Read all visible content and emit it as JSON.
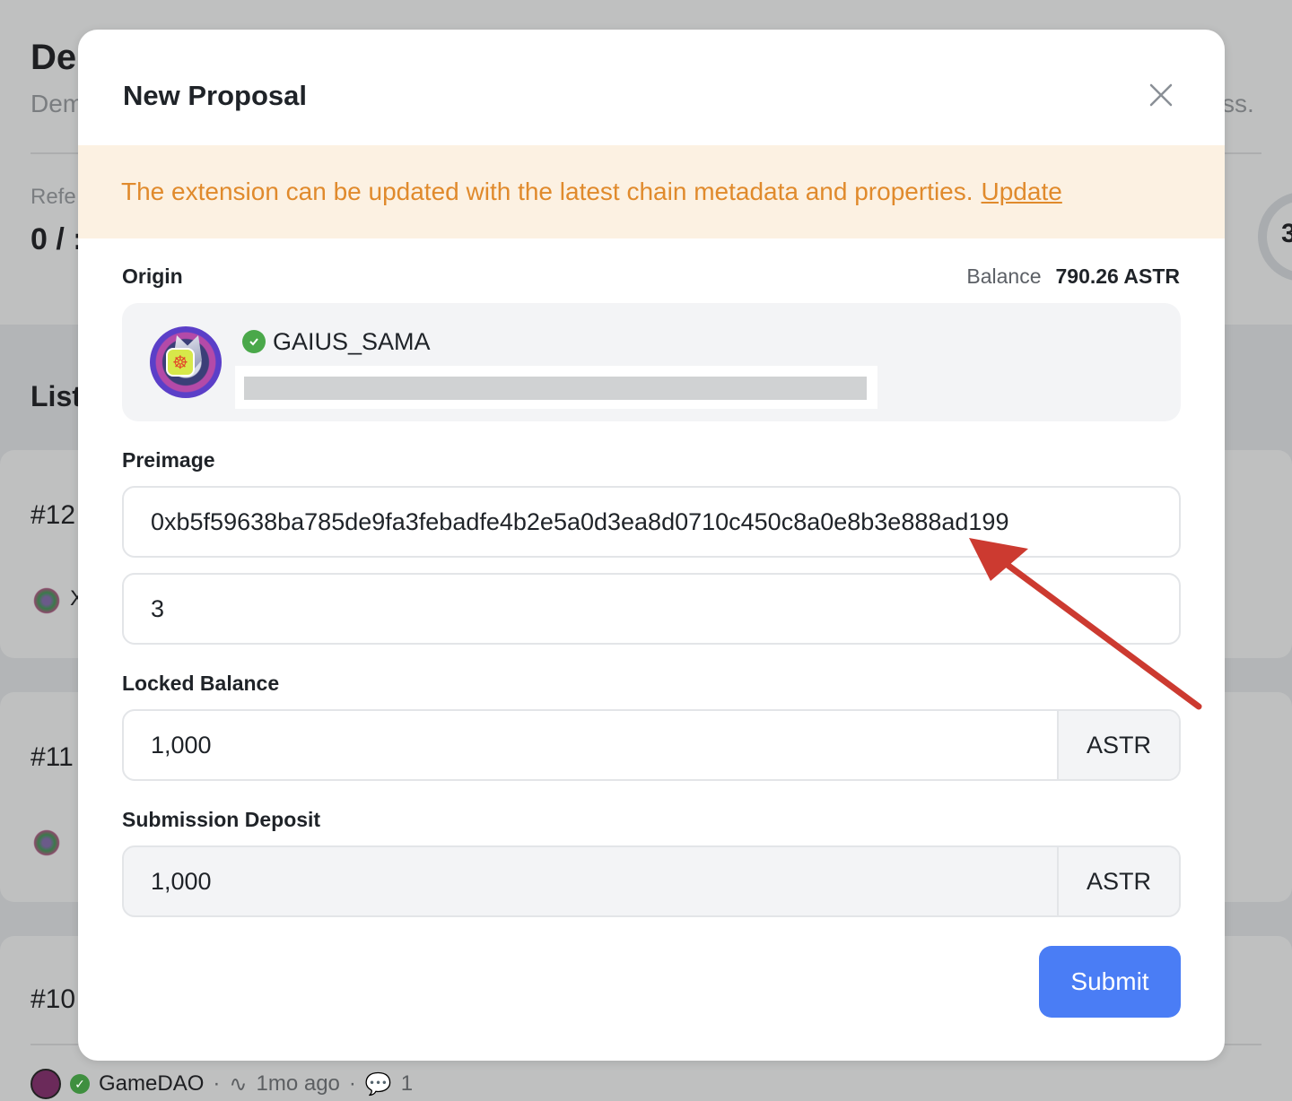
{
  "background": {
    "title": "De",
    "description_start": "Dem",
    "description_end": "ss.",
    "stat_label": "Refe",
    "stat_value": "0 / :",
    "ring_value": "3",
    "list_title": "List",
    "cards": [
      {
        "number": "#12",
        "meta": "X"
      },
      {
        "number": "#11"
      },
      {
        "number": "#10"
      }
    ],
    "footer": {
      "org": "GameDAO",
      "time": "1mo ago",
      "comments": "1"
    }
  },
  "modal": {
    "title": "New Proposal",
    "banner": {
      "text": "The extension can be updated with the latest chain metadata and properties.",
      "link": "Update"
    },
    "origin": {
      "label": "Origin",
      "balance_label": "Balance",
      "balance_value": "790.26 ASTR",
      "account_name": "GAIUS_SAMA"
    },
    "preimage": {
      "label": "Preimage",
      "hash": "0xb5f59638ba785de9fa3febadfe4b2e5a0d3ea8d0710c450c8a0e8b3e888ad199",
      "length": "3"
    },
    "locked_balance": {
      "label": "Locked Balance",
      "value": "1,000",
      "unit": "ASTR"
    },
    "submission_deposit": {
      "label": "Submission Deposit",
      "value": "1,000",
      "unit": "ASTR"
    },
    "submit_label": "Submit"
  },
  "colors": {
    "accent": "#4a7df5",
    "warning_text": "#e08a2c",
    "warning_bg": "#fcf1e2",
    "annotation_arrow": "#cc3a30"
  }
}
